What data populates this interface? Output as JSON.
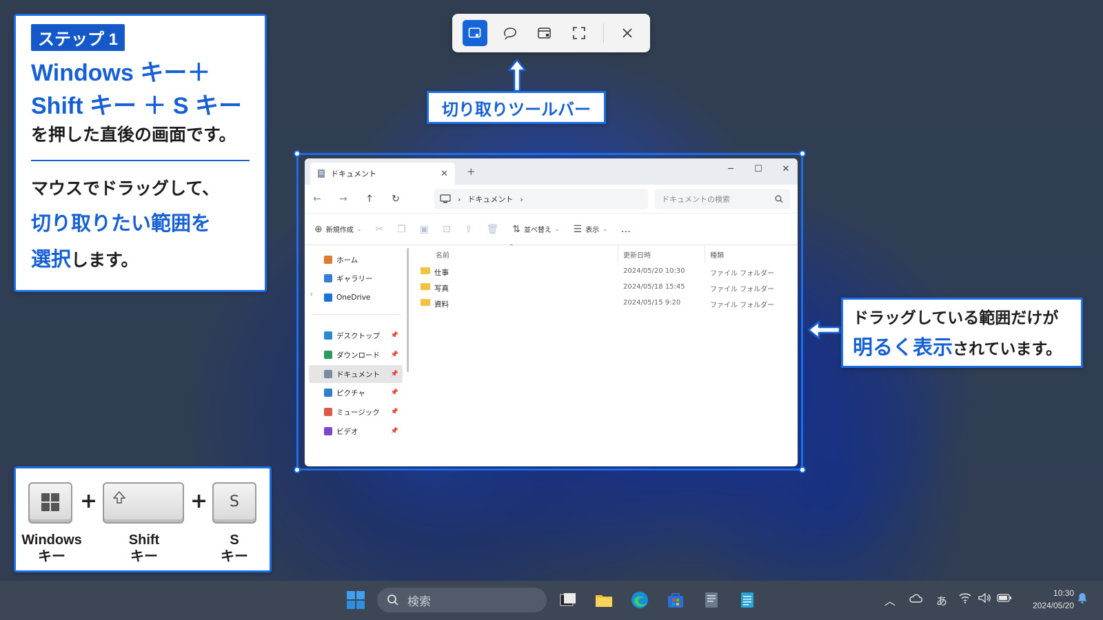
{
  "snip_toolbar": {
    "tools": [
      {
        "name": "rectangle-snip-icon",
        "active": true
      },
      {
        "name": "freeform-snip-icon",
        "active": false
      },
      {
        "name": "window-snip-icon",
        "active": false
      },
      {
        "name": "fullscreen-snip-icon",
        "active": false
      }
    ]
  },
  "step_panel": {
    "badge": "ステップ 1",
    "line1": "Windows キー＋",
    "line2": "Shift キー ＋ S キー",
    "line3": "を押した直後の画面です。",
    "line4": "マウスでドラッグして、",
    "line5": "切り取りたい範囲を",
    "line6_blue": "選択",
    "line6_rest": "します。"
  },
  "toolbar_label": "切り取りツールバー",
  "drag_label": {
    "line1": "ドラッグしている範囲だけが",
    "hl1": "明るく",
    "hl2": "表示",
    "rest": "されています。"
  },
  "keys": {
    "windows_name": "Windows",
    "shift_name": "Shift",
    "s_name": "S",
    "key_word": "キー",
    "s_cap": "S",
    "plus": "+"
  },
  "explorer": {
    "tab_title": "ドキュメント",
    "new_tab": "+",
    "path_sep": "›",
    "path_current": "ドキュメント",
    "search_placeholder": "ドキュメントの検索",
    "cmd_new": "新規作成",
    "cmd_sort": "並べ替え",
    "cmd_view": "表示",
    "cmd_more": "…",
    "nav": [
      {
        "label": "ホーム",
        "icon": "home-icon",
        "color": "#e07a2e",
        "pin": false
      },
      {
        "label": "ギャラリー",
        "icon": "gallery-icon",
        "color": "#3a7bd5",
        "pin": false
      },
      {
        "label": "OneDrive",
        "icon": "onedrive-icon",
        "color": "#1a73d9",
        "pin": false
      },
      {
        "label": "デスクトップ",
        "icon": "desktop-icon",
        "color": "#2b8ad1",
        "pin": true
      },
      {
        "label": "ダウンロード",
        "icon": "download-icon",
        "color": "#2b9a5e",
        "pin": true
      },
      {
        "label": "ドキュメント",
        "icon": "documents-icon",
        "color": "#7a8aa0",
        "pin": true
      },
      {
        "label": "ピクチャ",
        "icon": "pictures-icon",
        "color": "#2f7fd0",
        "pin": true
      },
      {
        "label": "ミュージック",
        "icon": "music-icon",
        "color": "#e0584a",
        "pin": true
      },
      {
        "label": "ビデオ",
        "icon": "videos-icon",
        "color": "#7b46c9",
        "pin": true
      }
    ],
    "columns": {
      "name": "名前",
      "modified": "更新日時",
      "type": "種類"
    },
    "files": [
      {
        "name": "仕事",
        "modified": "2024/05/20 10:30",
        "type": "ファイル フォルダー"
      },
      {
        "name": "写真",
        "modified": "2024/05/18 15:45",
        "type": "ファイル フォルダー"
      },
      {
        "name": "資料",
        "modified": "2024/05/15 9:20",
        "type": "ファイル フォルダー"
      }
    ]
  },
  "taskbar": {
    "search_placeholder": "検索",
    "ime": "あ",
    "time": "10:30",
    "date": "2024/05/20"
  },
  "colors": {
    "accent": "#1560d4",
    "selection_border": "#1b6ee6"
  }
}
